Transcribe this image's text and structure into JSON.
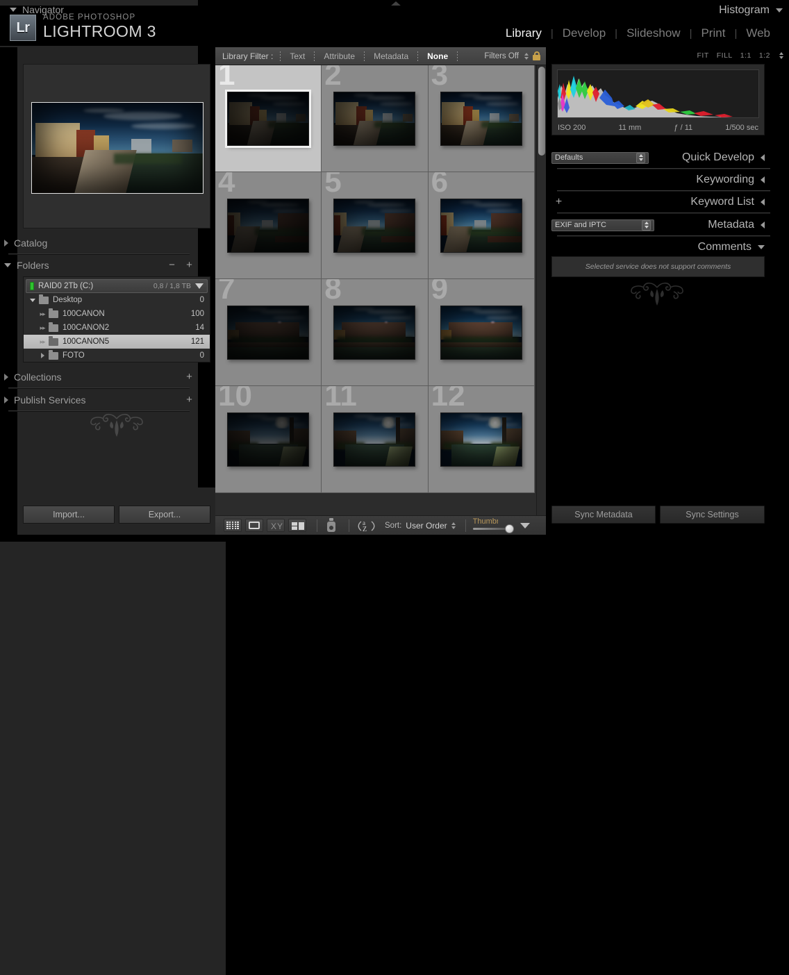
{
  "app": {
    "logo_text": "Lr",
    "brand_sub": "ADOBE PHOTOSHOP",
    "brand_main": "LIGHTROOM 3"
  },
  "modules": [
    {
      "label": "Library",
      "active": true
    },
    {
      "label": "Develop",
      "active": false
    },
    {
      "label": "Slideshow",
      "active": false
    },
    {
      "label": "Print",
      "active": false
    },
    {
      "label": "Web",
      "active": false
    }
  ],
  "navigator": {
    "title": "Navigator",
    "modes": [
      "FIT",
      "FILL",
      "1:1",
      "1:2"
    ]
  },
  "left_sections": {
    "catalog": "Catalog",
    "folders": "Folders",
    "collections": "Collections",
    "publish_services": "Publish Services"
  },
  "folders": {
    "volume": {
      "name": "RAID0 2Tb (C:)",
      "space": "0,8 / 1,8 TB"
    },
    "rows": [
      {
        "name": "Desktop",
        "count": "0",
        "indent": 0,
        "disclosure": "down",
        "selected": false
      },
      {
        "name": "100CANON",
        "count": "100",
        "indent": 1,
        "disclosure": "dots",
        "selected": false
      },
      {
        "name": "100CANON2",
        "count": "14",
        "indent": 1,
        "disclosure": "dots",
        "selected": false
      },
      {
        "name": "100CANON5",
        "count": "121",
        "indent": 1,
        "disclosure": "dots",
        "selected": true
      },
      {
        "name": "FOTO",
        "count": "0",
        "indent": 1,
        "disclosure": "right",
        "selected": false
      }
    ]
  },
  "left_buttons": {
    "import": "Import...",
    "export": "Export..."
  },
  "library_filter": {
    "label": "Library Filter :",
    "items": [
      {
        "label": "Text",
        "active": false
      },
      {
        "label": "Attribute",
        "active": false
      },
      {
        "label": "Metadata",
        "active": false
      },
      {
        "label": "None",
        "active": true
      }
    ],
    "filters_state": "Filters Off"
  },
  "grid": {
    "cells": [
      {
        "index": "1",
        "selected": true,
        "variant": "street",
        "exposure": 0
      },
      {
        "index": "2",
        "selected": false,
        "variant": "street",
        "exposure": 1
      },
      {
        "index": "3",
        "selected": false,
        "variant": "street",
        "exposure": 2
      },
      {
        "index": "4",
        "selected": false,
        "variant": "park",
        "exposure": 0
      },
      {
        "index": "5",
        "selected": false,
        "variant": "park",
        "exposure": 1
      },
      {
        "index": "6",
        "selected": false,
        "variant": "park",
        "exposure": 2
      },
      {
        "index": "7",
        "selected": false,
        "variant": "block",
        "exposure": 0
      },
      {
        "index": "8",
        "selected": false,
        "variant": "block",
        "exposure": 1
      },
      {
        "index": "9",
        "selected": false,
        "variant": "block",
        "exposure": 2
      },
      {
        "index": "10",
        "selected": false,
        "variant": "canal",
        "exposure": 0
      },
      {
        "index": "11",
        "selected": false,
        "variant": "canal",
        "exposure": 1
      },
      {
        "index": "12",
        "selected": false,
        "variant": "canal",
        "exposure": 2
      }
    ]
  },
  "toolbar": {
    "sort_label": "Sort:",
    "sort_value": "User Order",
    "thumbnails_label": "Thumbnails"
  },
  "right_panel": {
    "histogram_title": "Histogram",
    "quick_develop_title": "Quick Develop",
    "quick_develop_preset": "Defaults",
    "keywording_title": "Keywording",
    "keyword_list_title": "Keyword List",
    "metadata_title": "Metadata",
    "metadata_preset": "EXIF and IPTC",
    "comments_title": "Comments",
    "comments_message": "Selected service does not support comments",
    "exif": {
      "iso": "ISO 200",
      "focal": "11 mm",
      "aperture": "ƒ / 11",
      "shutter": "1/500 sec"
    },
    "buttons": {
      "sync_metadata": "Sync Metadata",
      "sync_settings": "Sync Settings"
    }
  },
  "colors": {
    "panel_bg": "#252525",
    "center_bg": "#2c2c2c",
    "cell_bg": "#8a8a8a",
    "cell_selected_bg": "#c4c4c4",
    "accent_text": "#ffffff",
    "volume_led": "#2ec22e",
    "lock_gold": "#c9a24a",
    "thumb_slider_label": "#b8975a"
  }
}
